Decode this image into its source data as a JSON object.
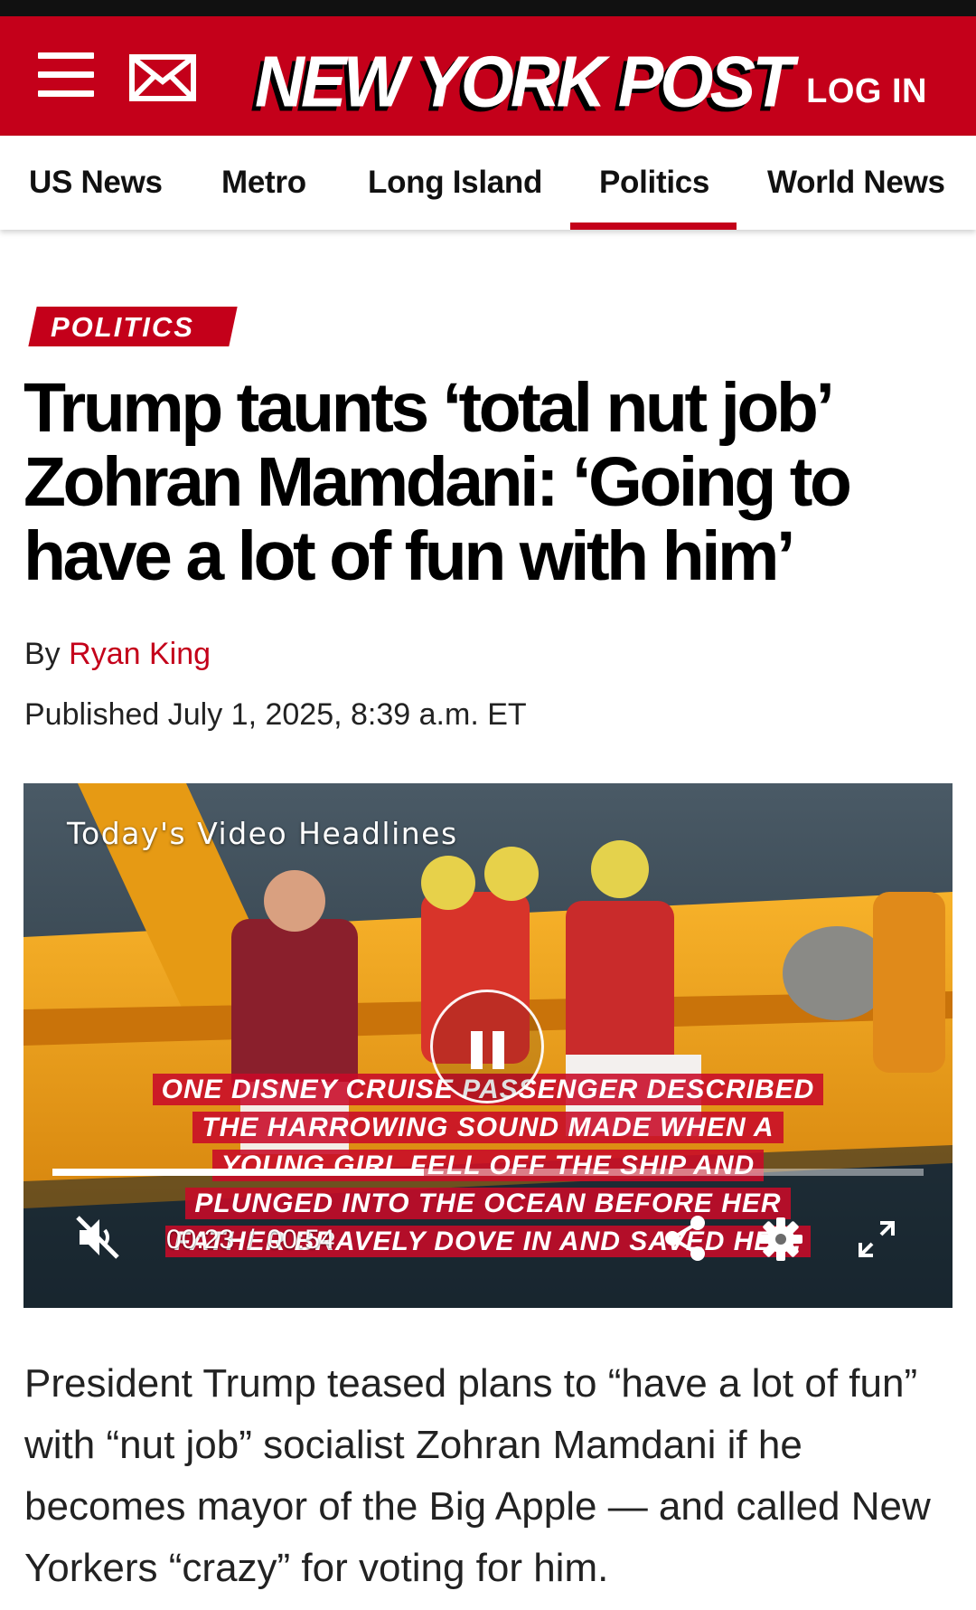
{
  "header": {
    "logo_text": "NEW YORK POST",
    "login_label": "LOG IN",
    "menu_icon": "hamburger-menu-icon",
    "mail_icon": "envelope-icon",
    "brand_color": "#c4001a"
  },
  "nav": {
    "items": [
      {
        "label": "US News"
      },
      {
        "label": "Metro"
      },
      {
        "label": "Long Island"
      },
      {
        "label": "Politics",
        "active": true
      },
      {
        "label": "World News"
      }
    ]
  },
  "article": {
    "category": "POLITICS",
    "headline": "Trump taunts ‘total nut job’ Zohran Mamdani: ‘Going to have a lot of fun with him’",
    "byline_prefix": "By",
    "author": "Ryan King",
    "published": "Published July 1, 2025, 8:39 a.m. ET",
    "body": "President Trump teased plans to “have a lot of fun” with “nut job” socialist Zohran Mamdani if he becomes mayor of the Big Apple — and called New Yorkers “crazy” for voting for him."
  },
  "video": {
    "title": "Today's Video Headlines",
    "captions": [
      "ONE DISNEY CRUISE PASSENGER DESCRIBED",
      "THE HARROWING SOUND MADE WHEN A",
      "YOUNG GIRL FELL OFF THE SHIP AND",
      "PLUNGED INTO THE OCEAN BEFORE HER",
      "FATHER BRAVELY DOVE IN AND SAVED HER."
    ],
    "current_time": "00:23",
    "time_separator": "/",
    "duration": "00:54",
    "progress_fraction": 0.426,
    "state": "playing",
    "muted": true,
    "icons": [
      "pause-icon",
      "muted-speaker-icon",
      "share-icon",
      "settings-gear-icon",
      "fullscreen-icon"
    ]
  }
}
